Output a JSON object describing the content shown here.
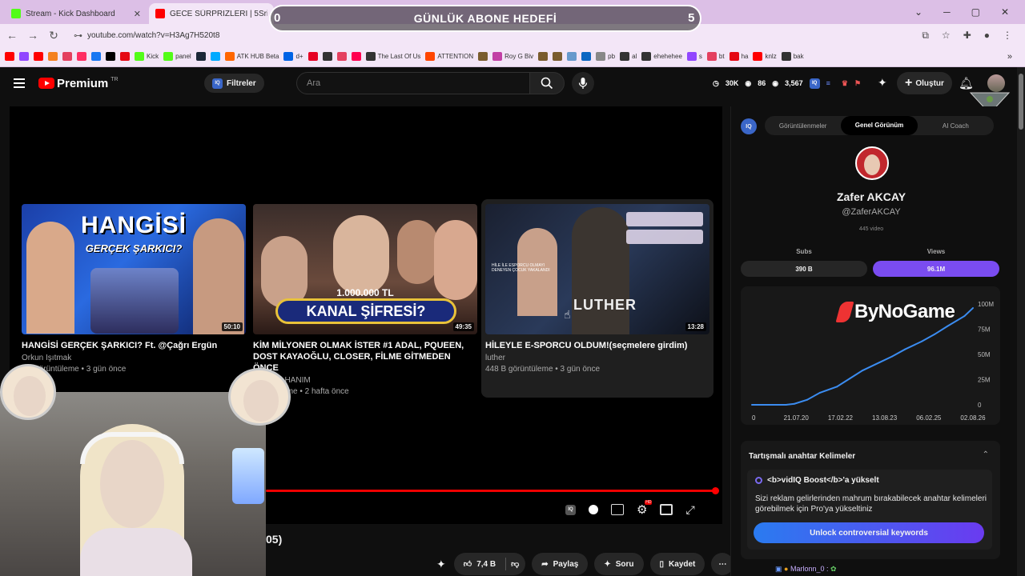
{
  "browser": {
    "tabs": [
      {
        "title": "Stream - Kick Dashboard",
        "icon": "kick-icon",
        "color": "#53fc18"
      },
      {
        "title": "GECE SÜRPRİZLERİ | 5Sriders |",
        "icon": "youtube-icon",
        "color": "#ff0000"
      }
    ],
    "url": "youtube.com/watch?v=H3Ag7H520t8",
    "bookmarks": [
      {
        "label": "",
        "color": "#ff0000"
      },
      {
        "label": "",
        "color": "#9146ff"
      },
      {
        "label": "",
        "color": "#ff0000"
      },
      {
        "label": "",
        "color": "#f48120"
      },
      {
        "label": "",
        "color": "#e4405f"
      },
      {
        "label": "",
        "color": "#ff2e63"
      },
      {
        "label": "",
        "color": "#1877f2"
      },
      {
        "label": "",
        "color": "#000000"
      },
      {
        "label": "",
        "color": "#e50914"
      },
      {
        "label": "Kick",
        "color": "#53fc18"
      },
      {
        "label": "panel",
        "color": "#53fc18"
      },
      {
        "label": "",
        "color": "#1b2838"
      },
      {
        "label": "",
        "color": "#00aaff"
      },
      {
        "label": "ATK HUB Beta",
        "color": "#ff6600"
      },
      {
        "label": "d+",
        "color": "#0063e5"
      },
      {
        "label": "",
        "color": "#e60023"
      },
      {
        "label": "",
        "color": "#333333"
      },
      {
        "label": "",
        "color": "#e4405f"
      },
      {
        "label": "",
        "color": "#ff0050"
      },
      {
        "label": "The Last Of Us",
        "color": "#333333"
      },
      {
        "label": "ATTENTION",
        "color": "#ff4500"
      },
      {
        "label": "",
        "color": "#7a5c2e"
      },
      {
        "label": "Roy G Biv",
        "color": "#c23fa5"
      },
      {
        "label": "",
        "color": "#7a5c2e"
      },
      {
        "label": "",
        "color": "#7a5c2e"
      },
      {
        "label": "",
        "color": "#6699cc"
      },
      {
        "label": "",
        "color": "#0a66c2"
      },
      {
        "label": "pb",
        "color": "#888888"
      },
      {
        "label": "al",
        "color": "#333333"
      },
      {
        "label": "ehehehee",
        "color": "#333333"
      },
      {
        "label": "s",
        "color": "#9146ff"
      },
      {
        "label": "bt",
        "color": "#e4405f"
      },
      {
        "label": "ha",
        "color": "#e50914"
      },
      {
        "label": "knlz",
        "color": "#ff0000"
      },
      {
        "label": "bak",
        "color": "#333333"
      }
    ]
  },
  "overlay": {
    "goal_title": "GÜNLÜK ABONE HEDEFİ",
    "goal_current": "0",
    "goal_target": "5"
  },
  "youtube": {
    "logo": "Premium",
    "logo_region": "TR",
    "filters_label": "Filtreler",
    "search_placeholder": "Ara",
    "stats": [
      {
        "icon": "clock-icon",
        "value": "30K"
      },
      {
        "icon": "eye-icon",
        "value": "86"
      },
      {
        "icon": "eye-icon",
        "value": "3,567"
      }
    ],
    "create_label": "Oluştur",
    "end_cards": [
      {
        "title": "HANGİSİ GERÇEK ŞARKICI? Ft. @Çağrı Ergün",
        "channel": "Orkun Işıtmak",
        "meta": "bin görüntüleme • 3 gün önce",
        "duration": "50:10",
        "thumb_text_1": "HANGİSİ",
        "thumb_text_2": "GERÇEK ŞARKICI?"
      },
      {
        "title": "KİM MİLYONER OLMAK İSTER #1 ADAL, PQUEEN, DOST KAYAOĞLU, CLOSER, FİLME GİTMEDEN ÖNCE",
        "channel": "SANİYE HANIM",
        "meta": "görüntüleme • 2 hafta önce",
        "duration": "49:35",
        "thumb_text_1": "1.000.000 TL",
        "thumb_text_2": "KANAL ŞİFRESİ?"
      },
      {
        "title": "HİLEYLE E-SPORCU OLDUM!(seçmelere girdim)",
        "channel": "luther",
        "meta": "448 B görüntüleme • 3 gün önce",
        "duration": "13:28",
        "thumb_text_1": "LUTHER",
        "thumb_text_2": "HİLE İLE ESPORCU OLMAYI DENEYEN ÇOCUK YAKALANDI"
      }
    ],
    "time_fragment": "05)",
    "progress": 1.0,
    "actions": {
      "likes": "7,4 B",
      "share": "Paylaş",
      "ask": "Soru",
      "save": "Kaydet"
    }
  },
  "vidiq": {
    "tabs": [
      "Görüntülenmeler",
      "Genel Görünüm",
      "AI Coach"
    ],
    "active_tab": "Genel Görünüm",
    "channel_name": "Zafer AKCAY",
    "handle": "@ZaferAKCAY",
    "video_count": "445 video",
    "subs_label": "Subs",
    "views_label": "Views",
    "subs_value": "390 B",
    "views_value": "96.1M",
    "brand_overlay": "ByNoGame",
    "keywords_title": "Tartışmalı anahtar Kelimeler",
    "boost_title": "<b>vidIQ Boost</b>'a yükselt",
    "boost_text": "Sizi reklam gelirlerinden mahrum bırakabilecek anahtar kelimeleri görebilmek için Pro'ya yükseltiniz",
    "unlock_label": "Unlock controversial keywords",
    "chat_user": "Marlonn_0 :"
  },
  "chart_data": {
    "type": "line",
    "title": "",
    "xlabel": "",
    "ylabel": "",
    "x_ticks": [
      "0",
      "21.07.20",
      "17.02.22",
      "13.08.23",
      "06.02.25",
      "02.08.26"
    ],
    "y_ticks": [
      "0",
      "25M",
      "50M",
      "75M",
      "100M"
    ],
    "ylim": [
      0,
      100
    ],
    "series": [
      {
        "x": [
          0,
          0.8,
          1.0,
          1.3,
          1.6,
          2.0,
          2.3,
          2.6,
          3.0,
          3.3,
          3.6,
          4.0,
          4.3,
          4.6,
          5.0,
          5.2
        ],
        "values": [
          0,
          0,
          1,
          5,
          12,
          18,
          26,
          34,
          42,
          48,
          55,
          63,
          70,
          78,
          88,
          96
        ]
      }
    ]
  }
}
